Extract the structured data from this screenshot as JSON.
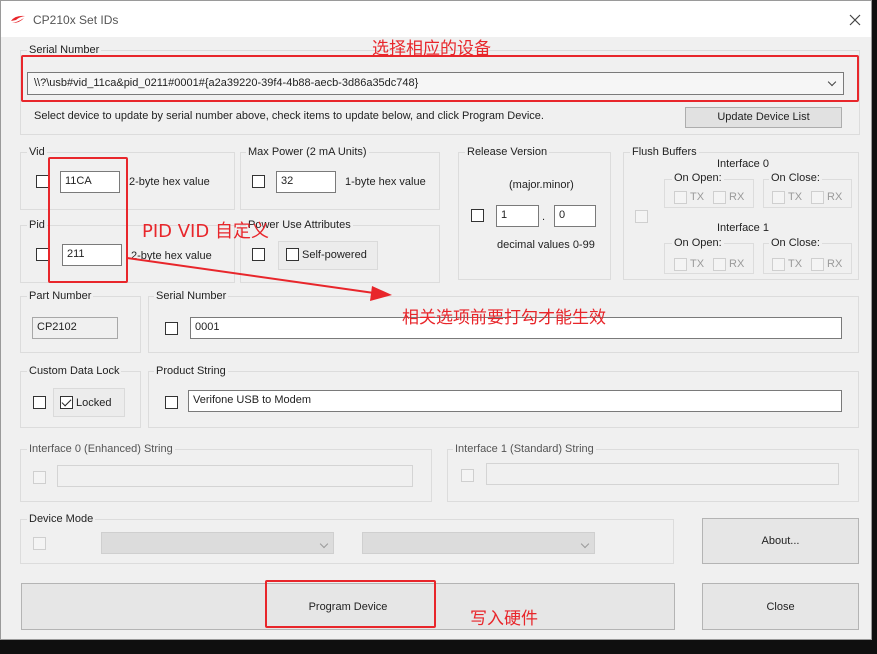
{
  "window": {
    "title": "CP210x Set IDs",
    "accent": "#e8262b"
  },
  "serial_number": {
    "group_label": "Serial Number",
    "selected_device": "\\\\?\\usb#vid_11ca&pid_0211#0001#{a2a39220-39f4-4b88-aecb-3d86a35dc748}",
    "instruction": "Select device to update by serial number above, check items to update below, and click Program Device.",
    "update_button": "Update Device List"
  },
  "vid": {
    "label": "Vid",
    "value": "11CA",
    "hint": "2-byte hex value"
  },
  "pid": {
    "label": "Pid",
    "value": "211",
    "hint": "2-byte hex value"
  },
  "max_power": {
    "label": "Max Power (2 mA Units)",
    "value": "32",
    "hint": "1-byte hex value"
  },
  "power_use": {
    "label": "Power Use Attributes",
    "self_powered": "Self-powered"
  },
  "release_version": {
    "label": "Release Version",
    "format": "(major.minor)",
    "major": "1",
    "dot": ".",
    "minor": "0",
    "hint": "decimal values 0-99"
  },
  "flush_buffers": {
    "label": "Flush Buffers",
    "interface0": "Interface 0",
    "interface1": "Interface 1",
    "on_open": "On Open:",
    "on_close": "On Close:",
    "tx": "TX",
    "rx": "RX"
  },
  "part_number": {
    "label": "Part Number",
    "value": "CP2102"
  },
  "serial_field": {
    "label": "Serial Number",
    "value": "0001"
  },
  "custom_data_lock": {
    "label": "Custom Data Lock",
    "locked": "Locked"
  },
  "product_string": {
    "label": "Product String",
    "value": "Verifone USB to Modem"
  },
  "interface0_string": {
    "label": "Interface 0 (Enhanced) String",
    "value": ""
  },
  "interface1_string": {
    "label": "Interface 1 (Standard) String",
    "value": ""
  },
  "device_mode": {
    "label": "Device Mode"
  },
  "buttons": {
    "about": "About...",
    "program": "Program Device",
    "close": "Close"
  },
  "annotations": {
    "select_device": "选择相应的设备",
    "pid_vid": "PID VID 自定义",
    "check_items": "相关选项前要打勾才能生效",
    "write_hw": "写入硬件"
  }
}
